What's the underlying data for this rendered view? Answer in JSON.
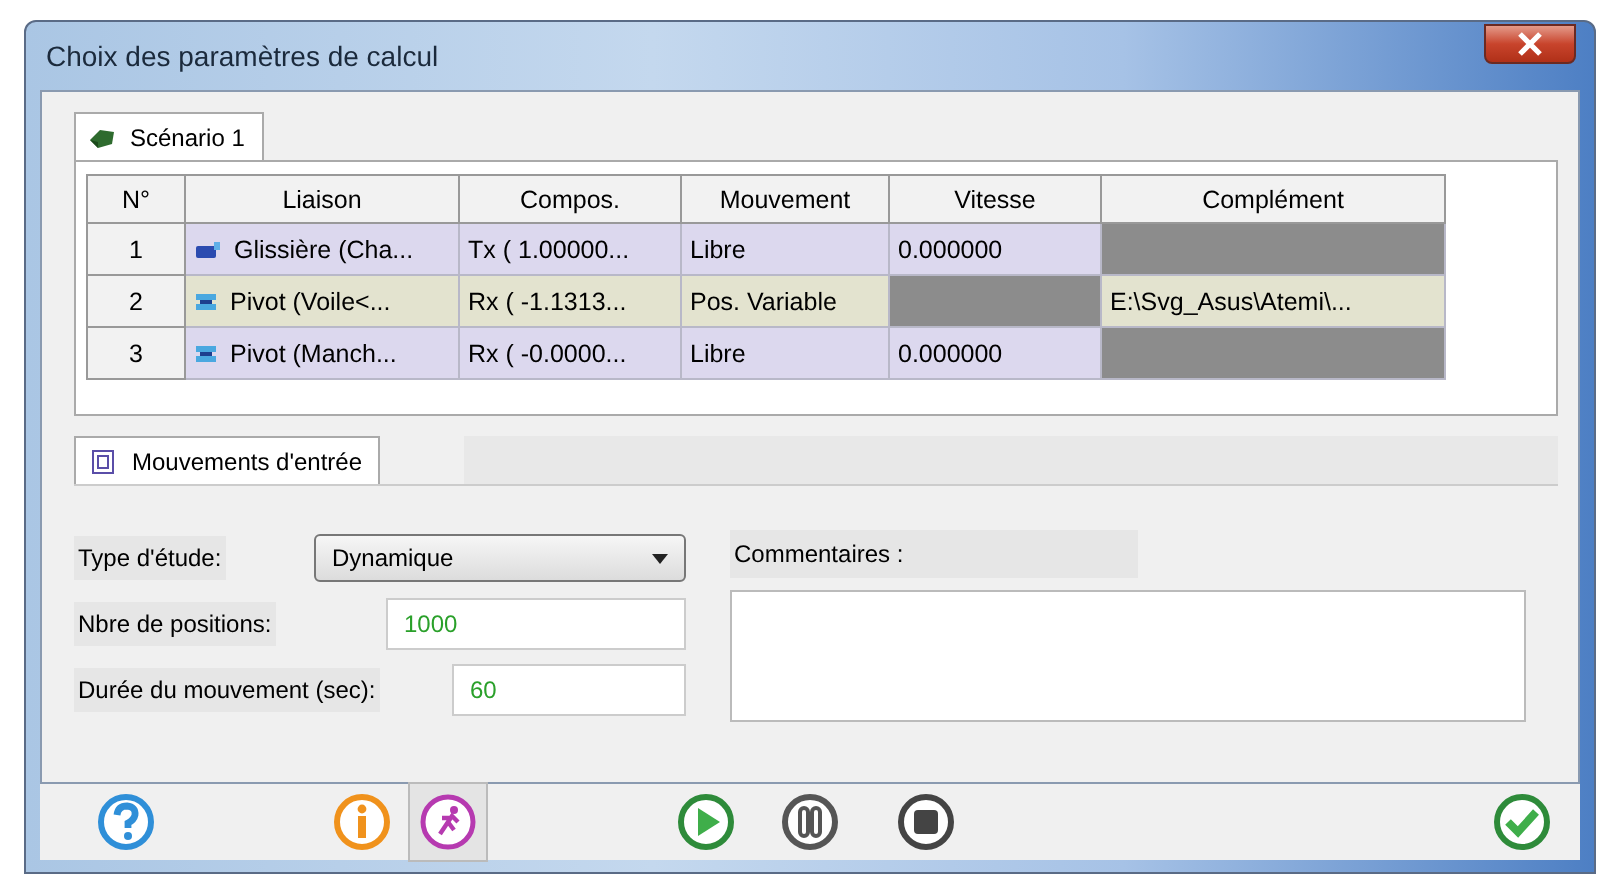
{
  "window": {
    "title": "Choix des paramètres de calcul"
  },
  "tabs": [
    {
      "label": "Scénario 1",
      "selected": true
    }
  ],
  "table": {
    "columns": [
      "N°",
      "Liaison",
      "Compos.",
      "Mouvement",
      "Vitesse",
      "Complément"
    ],
    "rows": [
      {
        "color": "#dcd8ee",
        "cells": [
          {
            "text": "1"
          },
          {
            "text": "Glissière (Cha...",
            "kind": "slider"
          },
          {
            "text": "Tx ( 1.00000..."
          },
          {
            "text": "Libre"
          },
          {
            "text": "0.000000"
          },
          {
            "disabled": true
          }
        ]
      },
      {
        "color": "#e3e3cf",
        "cells": [
          {
            "text": "2"
          },
          {
            "text": "Pivot (Voile<...",
            "kind": "pivot"
          },
          {
            "text": "Rx ( -1.1313..."
          },
          {
            "text": "Pos. Variable"
          },
          {
            "disabled": true
          },
          {
            "text": "E:\\Svg_Asus\\Atemi\\..."
          }
        ]
      },
      {
        "color": "#dcd8ee",
        "cells": [
          {
            "text": "3"
          },
          {
            "text": "Pivot (Manch...",
            "kind": "pivot"
          },
          {
            "text": "Rx ( -0.0000..."
          },
          {
            "text": "Libre"
          },
          {
            "text": "0.000000"
          },
          {
            "disabled": true
          }
        ]
      }
    ]
  },
  "subtabs": [
    {
      "label": "Mouvements d'entrée",
      "selected": true
    }
  ],
  "form": {
    "type_label": "Type d'étude:",
    "type_value": "Dynamique",
    "positions_label": "Nbre de positions:",
    "positions_value": "1000",
    "duration_label": "Durée du mouvement (sec):",
    "duration_value": "60",
    "comments_label": "Commentaires :"
  },
  "toolbar": [
    {
      "kind": "help"
    },
    {
      "kind": "info"
    },
    {
      "kind": "runner",
      "pressed": true
    },
    {
      "kind": "play"
    },
    {
      "kind": "pause"
    },
    {
      "kind": "stop"
    },
    {
      "kind": "ok"
    }
  ]
}
